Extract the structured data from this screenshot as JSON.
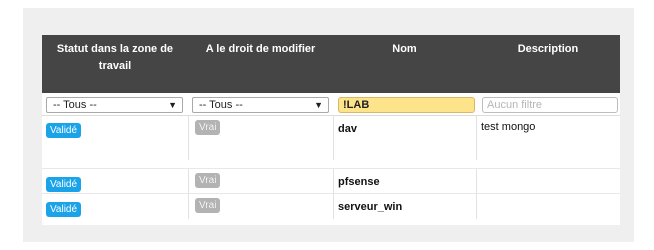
{
  "table": {
    "columns": [
      {
        "label": "Statut dans la zone de travail"
      },
      {
        "label": "A le droit de modifier"
      },
      {
        "label": "Nom"
      },
      {
        "label": "Description"
      }
    ],
    "filters": {
      "statut": {
        "value": "-- Tous --"
      },
      "droit": {
        "value": "-- Tous --"
      },
      "nom": {
        "value": "!LAB"
      },
      "description": {
        "placeholder": "Aucun filtre"
      }
    },
    "rows": [
      {
        "statut": "Validé",
        "droit": "Vrai",
        "nom": "dav",
        "description": "test mongo"
      },
      {
        "statut": "Validé",
        "droit": "Vrai",
        "nom": "pfsense",
        "description": ""
      },
      {
        "statut": "Validé",
        "droit": "Vrai",
        "nom": "serveur_win",
        "description": ""
      }
    ]
  },
  "colors": {
    "header_bg": "#454545",
    "status_badge": "#1aa3e8",
    "bool_badge": "#b3b3b3",
    "active_filter": "#fde48a"
  }
}
